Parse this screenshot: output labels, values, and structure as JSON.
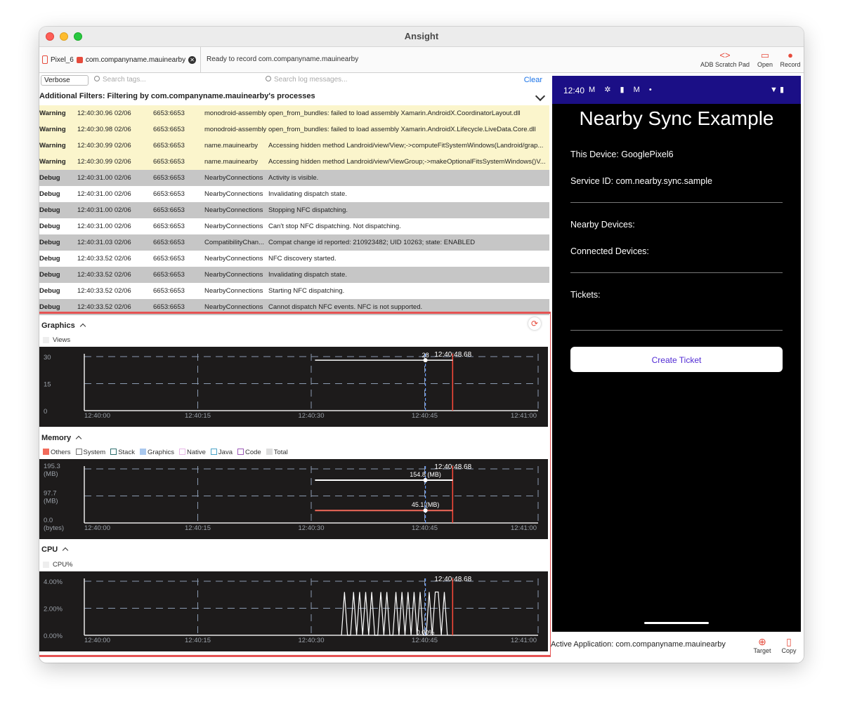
{
  "window": {
    "title": "Ansight"
  },
  "toolbar": {
    "device": "Pixel_6",
    "app": "com.companyname.mauinearby",
    "status": "Ready to record com.companyname.mauinearby",
    "buttons": [
      {
        "label": "ADB Scratch Pad",
        "icon": "code-icon"
      },
      {
        "label": "Open",
        "icon": "folder-icon"
      },
      {
        "label": "Record",
        "icon": "record-icon"
      }
    ]
  },
  "filters": {
    "level": "Verbose",
    "tags_placeholder": "Search tags...",
    "messages_placeholder": "Search log messages...",
    "clear": "Clear",
    "additional": "Additional Filters: Filtering by com.companyname.mauinearby's processes"
  },
  "logs": [
    {
      "level": "Warning",
      "time": "12:40:30.96 02/06",
      "pid": "6653:6653",
      "tag": "monodroid-assembly",
      "msg": "open_from_bundles: failed to load assembly Xamarin.AndroidX.CoordinatorLayout.dll"
    },
    {
      "level": "Warning",
      "time": "12:40:30.98 02/06",
      "pid": "6653:6653",
      "tag": "monodroid-assembly",
      "msg": "open_from_bundles: failed to load assembly Xamarin.AndroidX.Lifecycle.LiveData.Core.dll"
    },
    {
      "level": "Warning",
      "time": "12:40:30.99 02/06",
      "pid": "6653:6653",
      "tag": "name.mauinearby",
      "msg": "Accessing hidden method Landroid/view/View;->computeFitSystemWindows(Landroid/grap..."
    },
    {
      "level": "Warning",
      "time": "12:40:30.99 02/06",
      "pid": "6653:6653",
      "tag": "name.mauinearby",
      "msg": "Accessing hidden method Landroid/view/ViewGroup;->makeOptionalFitsSystemWindows()V..."
    },
    {
      "level": "Debug",
      "time": "12:40:31.00 02/06",
      "pid": "6653:6653",
      "tag": "NearbyConnections",
      "msg": "Activity is visible."
    },
    {
      "level": "Debug",
      "time": "12:40:31.00 02/06",
      "pid": "6653:6653",
      "tag": "NearbyConnections",
      "msg": "Invalidating dispatch state."
    },
    {
      "level": "Debug",
      "time": "12:40:31.00 02/06",
      "pid": "6653:6653",
      "tag": "NearbyConnections",
      "msg": "Stopping NFC dispatching."
    },
    {
      "level": "Debug",
      "time": "12:40:31.00 02/06",
      "pid": "6653:6653",
      "tag": "NearbyConnections",
      "msg": "Can't stop NFC dispatching. Not dispatching."
    },
    {
      "level": "Debug",
      "time": "12:40:31.03 02/06",
      "pid": "6653:6653",
      "tag": "CompatibilityChan...",
      "msg": "Compat change id reported: 210923482; UID 10263; state: ENABLED"
    },
    {
      "level": "Debug",
      "time": "12:40:33.52 02/06",
      "pid": "6653:6653",
      "tag": "NearbyConnections",
      "msg": "NFC discovery started."
    },
    {
      "level": "Debug",
      "time": "12:40:33.52 02/06",
      "pid": "6653:6653",
      "tag": "NearbyConnections",
      "msg": "Invalidating dispatch state."
    },
    {
      "level": "Debug",
      "time": "12:40:33.52 02/06",
      "pid": "6653:6653",
      "tag": "NearbyConnections",
      "msg": "Starting NFC dispatching."
    },
    {
      "level": "Debug",
      "time": "12:40:33.52 02/06",
      "pid": "6653:6653",
      "tag": "NearbyConnections",
      "msg": "Cannot dispatch NFC events. NFC is not supported."
    }
  ],
  "graphics": {
    "title": "Graphics",
    "legend": "Views"
  },
  "memory": {
    "title": "Memory",
    "legend": [
      {
        "label": "Others",
        "color": "#f26b5b",
        "filled": true
      },
      {
        "label": "System",
        "color": "#777777",
        "filled": false
      },
      {
        "label": "Stack",
        "color": "#2f6f6f",
        "filled": false
      },
      {
        "label": "Graphics",
        "color": "#a9c8ee",
        "filled": true
      },
      {
        "label": "Native",
        "color": "#e6b7e6",
        "filled": false
      },
      {
        "label": "Java",
        "color": "#4aa3c8",
        "filled": false
      },
      {
        "label": "Code",
        "color": "#9b59b6",
        "filled": false
      },
      {
        "label": "Total",
        "color": "#dddddd",
        "filled": true
      }
    ]
  },
  "cpu": {
    "title": "CPU",
    "legend": "CPU%"
  },
  "chart_data": [
    {
      "type": "line",
      "name": "graphics-views",
      "x_ticks": [
        "12:40:00",
        "12:40:15",
        "12:40:30",
        "12:40:45",
        "12:41:00"
      ],
      "y_ticks": [
        "30",
        "15",
        "0"
      ],
      "ylim": [
        0,
        30
      ],
      "cursor_label": "28",
      "now_label": "12:40:48.68",
      "series": [
        {
          "name": "Views",
          "x": [
            30.5,
            48.7
          ],
          "y": [
            28,
            28
          ]
        }
      ]
    },
    {
      "type": "line",
      "name": "memory",
      "x_ticks": [
        "12:40:00",
        "12:40:15",
        "12:40:30",
        "12:40:45",
        "12:41:00"
      ],
      "y_ticks": [
        "195.3\n(MB)",
        "97.7\n(MB)",
        "0.0\n(bytes)"
      ],
      "ylim": [
        0,
        195.3
      ],
      "now_label": "12:40:48.68",
      "annotations": [
        "154.8 (MB)",
        "45.1 (MB)"
      ],
      "series": [
        {
          "name": "Total",
          "x": [
            30.5,
            48.7
          ],
          "y": [
            154.8,
            154.8
          ]
        },
        {
          "name": "Others",
          "x": [
            30.5,
            48.7
          ],
          "y": [
            45.1,
            45.1
          ]
        }
      ]
    },
    {
      "type": "line",
      "name": "cpu",
      "x_ticks": [
        "12:40:00",
        "12:40:15",
        "12:40:30",
        "12:40:45",
        "12:41:00"
      ],
      "y_ticks": [
        "4.00%",
        "2.00%",
        "0.00%"
      ],
      "ylim": [
        0,
        4
      ],
      "now_label": "12:40:48.68",
      "cursor_label": "0.00%",
      "series": [
        {
          "name": "CPU%",
          "x": [
            34.0,
            34.4,
            34.8,
            35.2,
            35.6,
            36.0,
            36.4,
            36.8,
            37.2,
            37.6,
            38.0,
            38.4,
            38.8,
            39.2,
            39.6,
            40.0,
            40.4,
            40.8,
            41.2,
            41.6,
            42.0,
            42.4,
            42.8,
            43.2,
            43.6,
            44.0,
            44.4,
            44.8,
            45.2,
            45.6,
            46.0,
            46.4,
            46.8,
            47.2,
            47.6,
            48.0
          ],
          "y": [
            0,
            3.2,
            0,
            0,
            3.2,
            0,
            3.2,
            0,
            3.2,
            0,
            3.2,
            0,
            0,
            3.2,
            0,
            3.2,
            0,
            0,
            3.2,
            0,
            3.2,
            0,
            3.2,
            0,
            3.2,
            0,
            3.2,
            0,
            0,
            3.2,
            0,
            3.2,
            3.2,
            0,
            3.2,
            0
          ]
        }
      ]
    }
  ],
  "device_app": {
    "time": "12:40",
    "title": "Nearby Sync Example",
    "this_device": "This Device: GooglePixel6",
    "service_id": "Service ID: com.nearby.sync.sample",
    "nearby": "Nearby Devices:",
    "connected": "Connected Devices:",
    "tickets": "Tickets:",
    "button": "Create Ticket"
  },
  "footer": {
    "active_app": "Active Application: com.companyname.mauinearby",
    "buttons": [
      {
        "label": "Target",
        "icon": "target-icon"
      },
      {
        "label": "Copy",
        "icon": "copy-icon"
      }
    ]
  }
}
